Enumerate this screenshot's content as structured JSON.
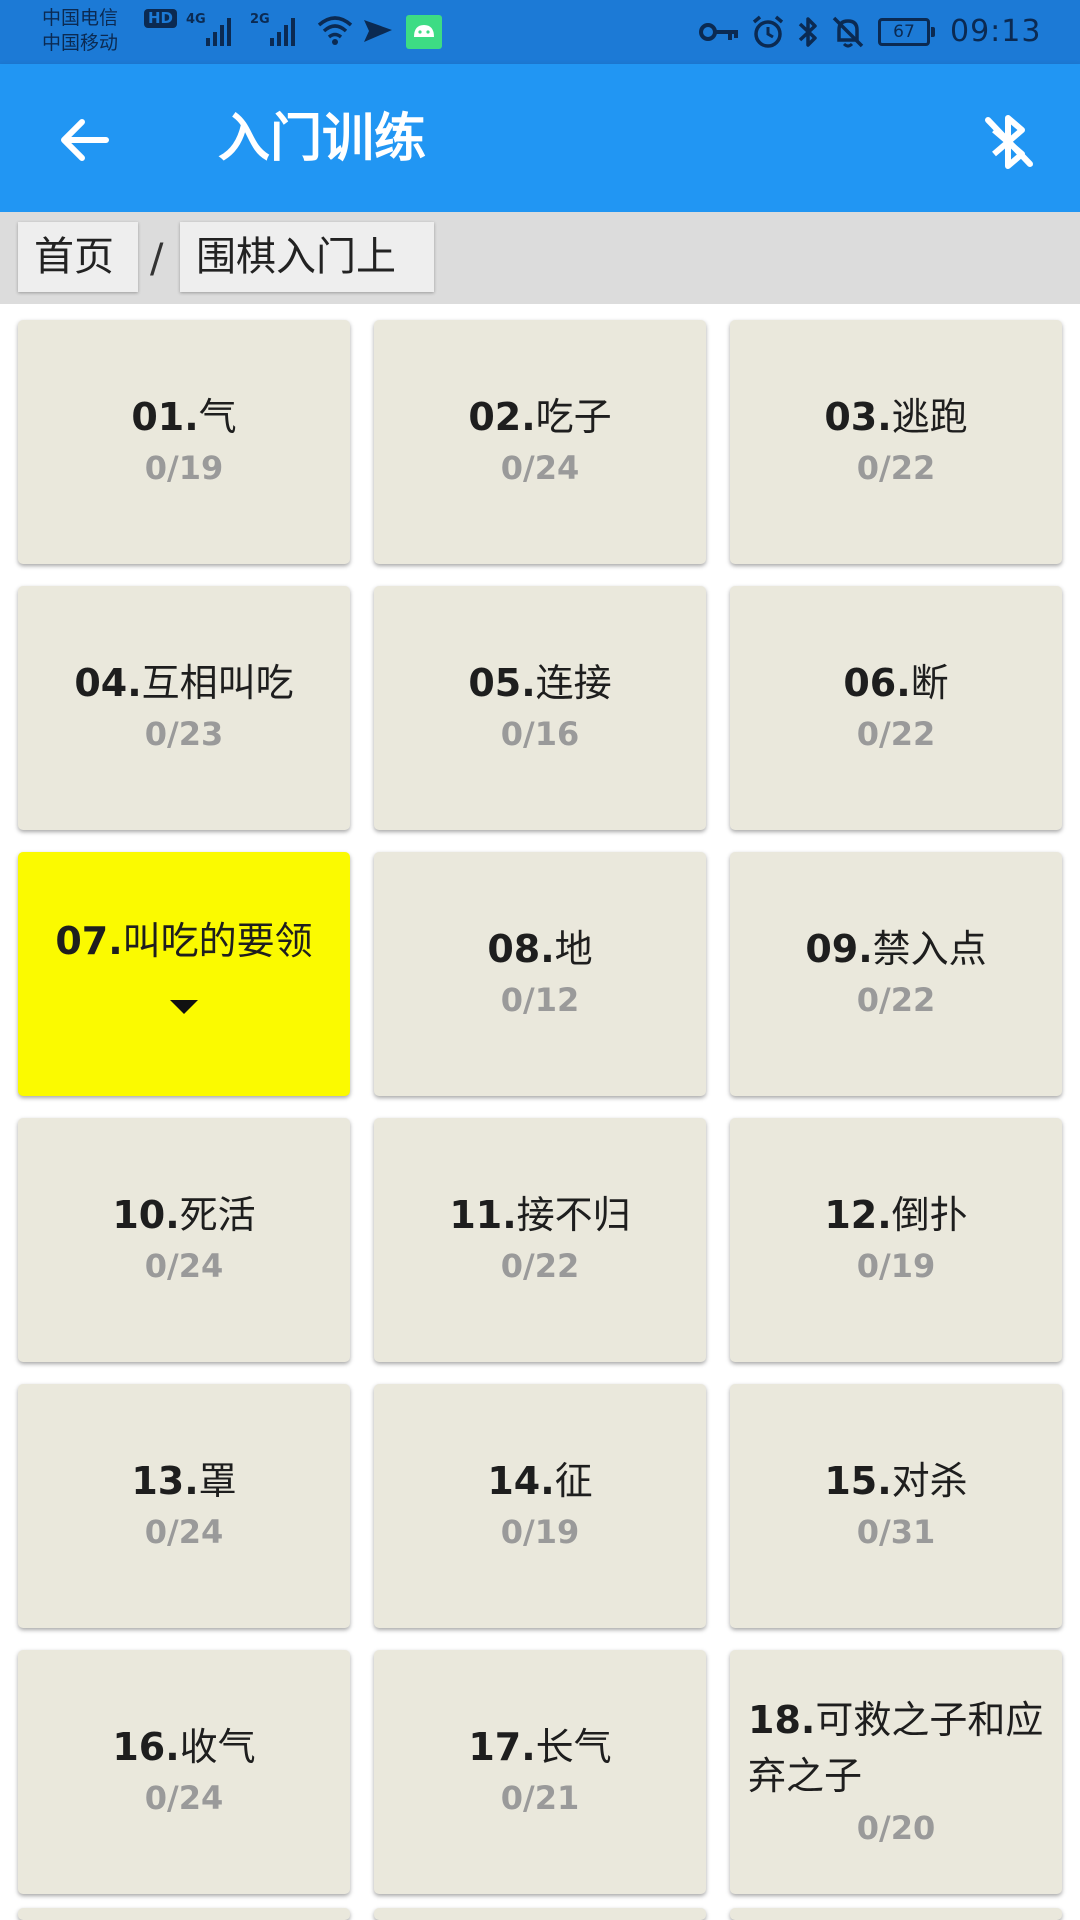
{
  "status_bar": {
    "carrier1": "中国电信",
    "carrier2": "中国移动",
    "hd": "HD",
    "net1": "4G",
    "net2": "2G",
    "battery": "67",
    "time": "09:13"
  },
  "app_bar": {
    "title": "入门训练"
  },
  "breadcrumb": {
    "home": "首页",
    "separator": "/",
    "current": "围棋入门上"
  },
  "lessons": [
    {
      "num": "01.",
      "title": "气",
      "count": "0/19"
    },
    {
      "num": "02.",
      "title": "吃子",
      "count": "0/24"
    },
    {
      "num": "03.",
      "title": "逃跑",
      "count": "0/22"
    },
    {
      "num": "04.",
      "title": "互相叫吃",
      "count": "0/23"
    },
    {
      "num": "05.",
      "title": "连接",
      "count": "0/16"
    },
    {
      "num": "06.",
      "title": "断",
      "count": "0/22"
    },
    {
      "num": "07.",
      "title": "叫吃的要领",
      "count": ""
    },
    {
      "num": "08.",
      "title": "地",
      "count": "0/12"
    },
    {
      "num": "09.",
      "title": "禁入点",
      "count": "0/22"
    },
    {
      "num": "10.",
      "title": "死活",
      "count": "0/24"
    },
    {
      "num": "11.",
      "title": "接不归",
      "count": "0/22"
    },
    {
      "num": "12.",
      "title": "倒扑",
      "count": "0/19"
    },
    {
      "num": "13.",
      "title": "罩",
      "count": "0/24"
    },
    {
      "num": "14.",
      "title": "征",
      "count": "0/19"
    },
    {
      "num": "15.",
      "title": "对杀",
      "count": "0/31"
    },
    {
      "num": "16.",
      "title": "收气",
      "count": "0/24"
    },
    {
      "num": "17.",
      "title": "长气",
      "count": "0/21"
    },
    {
      "num": "18.",
      "title": "可救之子和应弃之子",
      "count": "0/20"
    }
  ],
  "colors": {
    "app_bar": "#2196f3",
    "status_bar": "#1c7ad6",
    "tile": "#eae8dc",
    "tile_selected": "#fbfa00"
  }
}
